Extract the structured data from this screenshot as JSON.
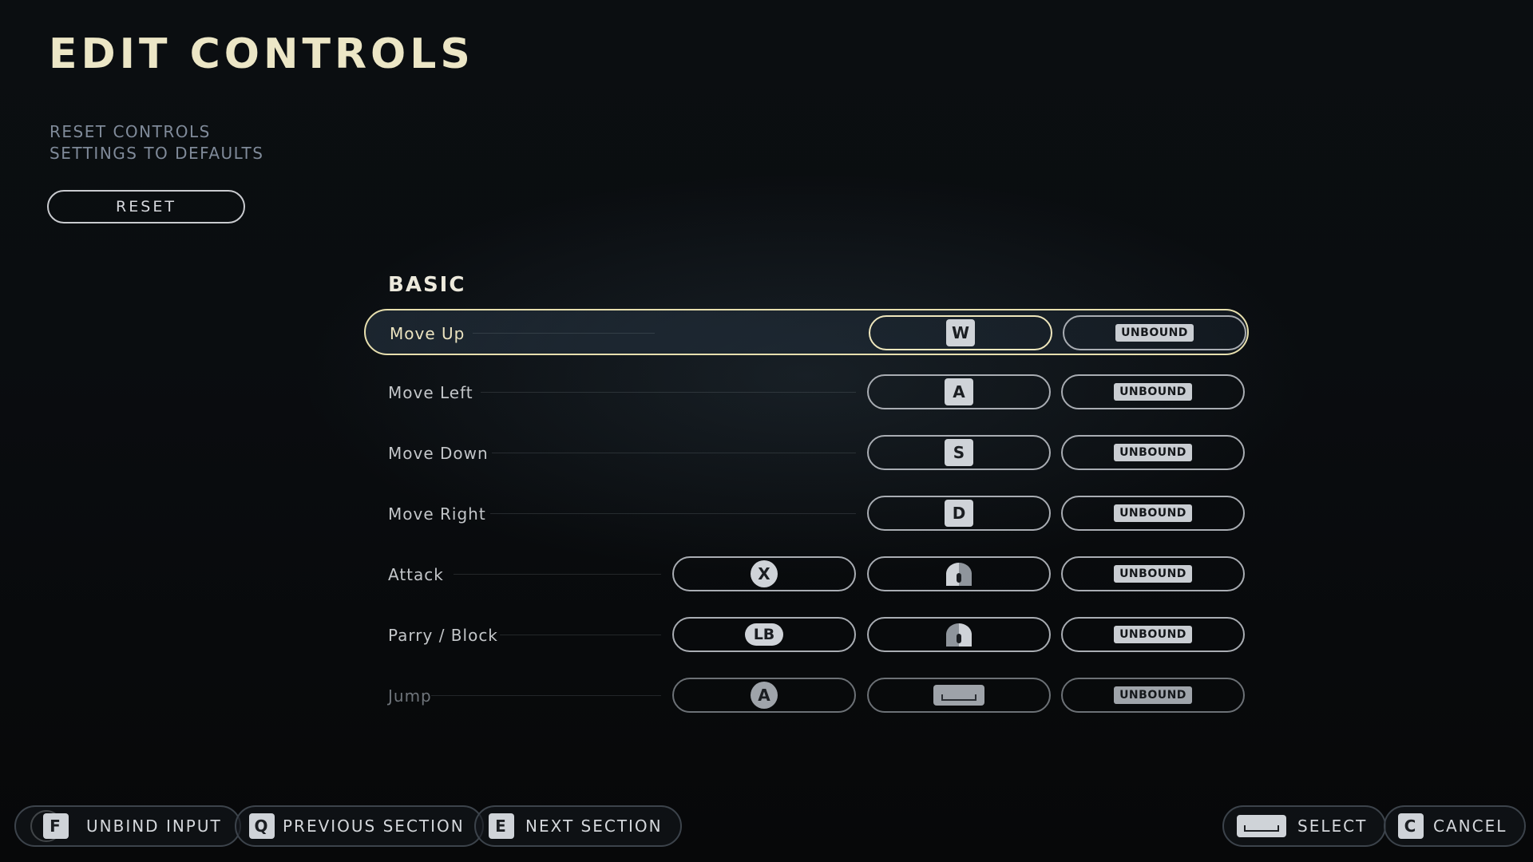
{
  "page": {
    "title": "EDIT CONTROLS",
    "reset_description": [
      "RESET CONTROLS",
      "SETTINGS TO DEFAULTS"
    ],
    "reset_button": "RESET"
  },
  "section": {
    "title": "BASIC",
    "rows": [
      {
        "label": "Move Up",
        "selected": true,
        "controller": null,
        "primary": {
          "type": "key",
          "text": "W"
        },
        "secondary": "UNBOUND"
      },
      {
        "label": "Move Left",
        "controller": null,
        "primary": {
          "type": "key",
          "text": "A"
        },
        "secondary": "UNBOUND"
      },
      {
        "label": "Move Down",
        "controller": null,
        "primary": {
          "type": "key",
          "text": "S"
        },
        "secondary": "UNBOUND"
      },
      {
        "label": "Move Right",
        "controller": null,
        "primary": {
          "type": "key",
          "text": "D"
        },
        "secondary": "UNBOUND"
      },
      {
        "label": "Attack",
        "controller": {
          "type": "pad-button",
          "text": "X"
        },
        "primary": {
          "type": "mouse",
          "icon": "mouse-left-button-icon"
        },
        "secondary": "UNBOUND"
      },
      {
        "label": "Parry / Block",
        "controller": {
          "type": "pad-bumper",
          "text": "LB"
        },
        "primary": {
          "type": "mouse",
          "icon": "mouse-right-button-icon"
        },
        "secondary": "UNBOUND"
      },
      {
        "label": "Jump",
        "dim": true,
        "controller": {
          "type": "pad-button",
          "text": "A"
        },
        "primary": {
          "type": "spacebar",
          "icon": "spacebar-key-icon"
        },
        "secondary": "UNBOUND"
      }
    ]
  },
  "footer": {
    "unbind": {
      "key": "F",
      "label": "UNBIND INPUT"
    },
    "previous": {
      "key": "Q",
      "label": "PREVIOUS SECTION"
    },
    "next": {
      "key": "E",
      "label": "NEXT SECTION"
    },
    "select": {
      "key_icon": "spacebar-key-icon",
      "label": "SELECT"
    },
    "cancel": {
      "key": "C",
      "label": "CANCEL"
    }
  },
  "colors": {
    "accent_selected": "#e7dfae",
    "title": "#ece6c6",
    "subtext": "#7f8a99"
  }
}
